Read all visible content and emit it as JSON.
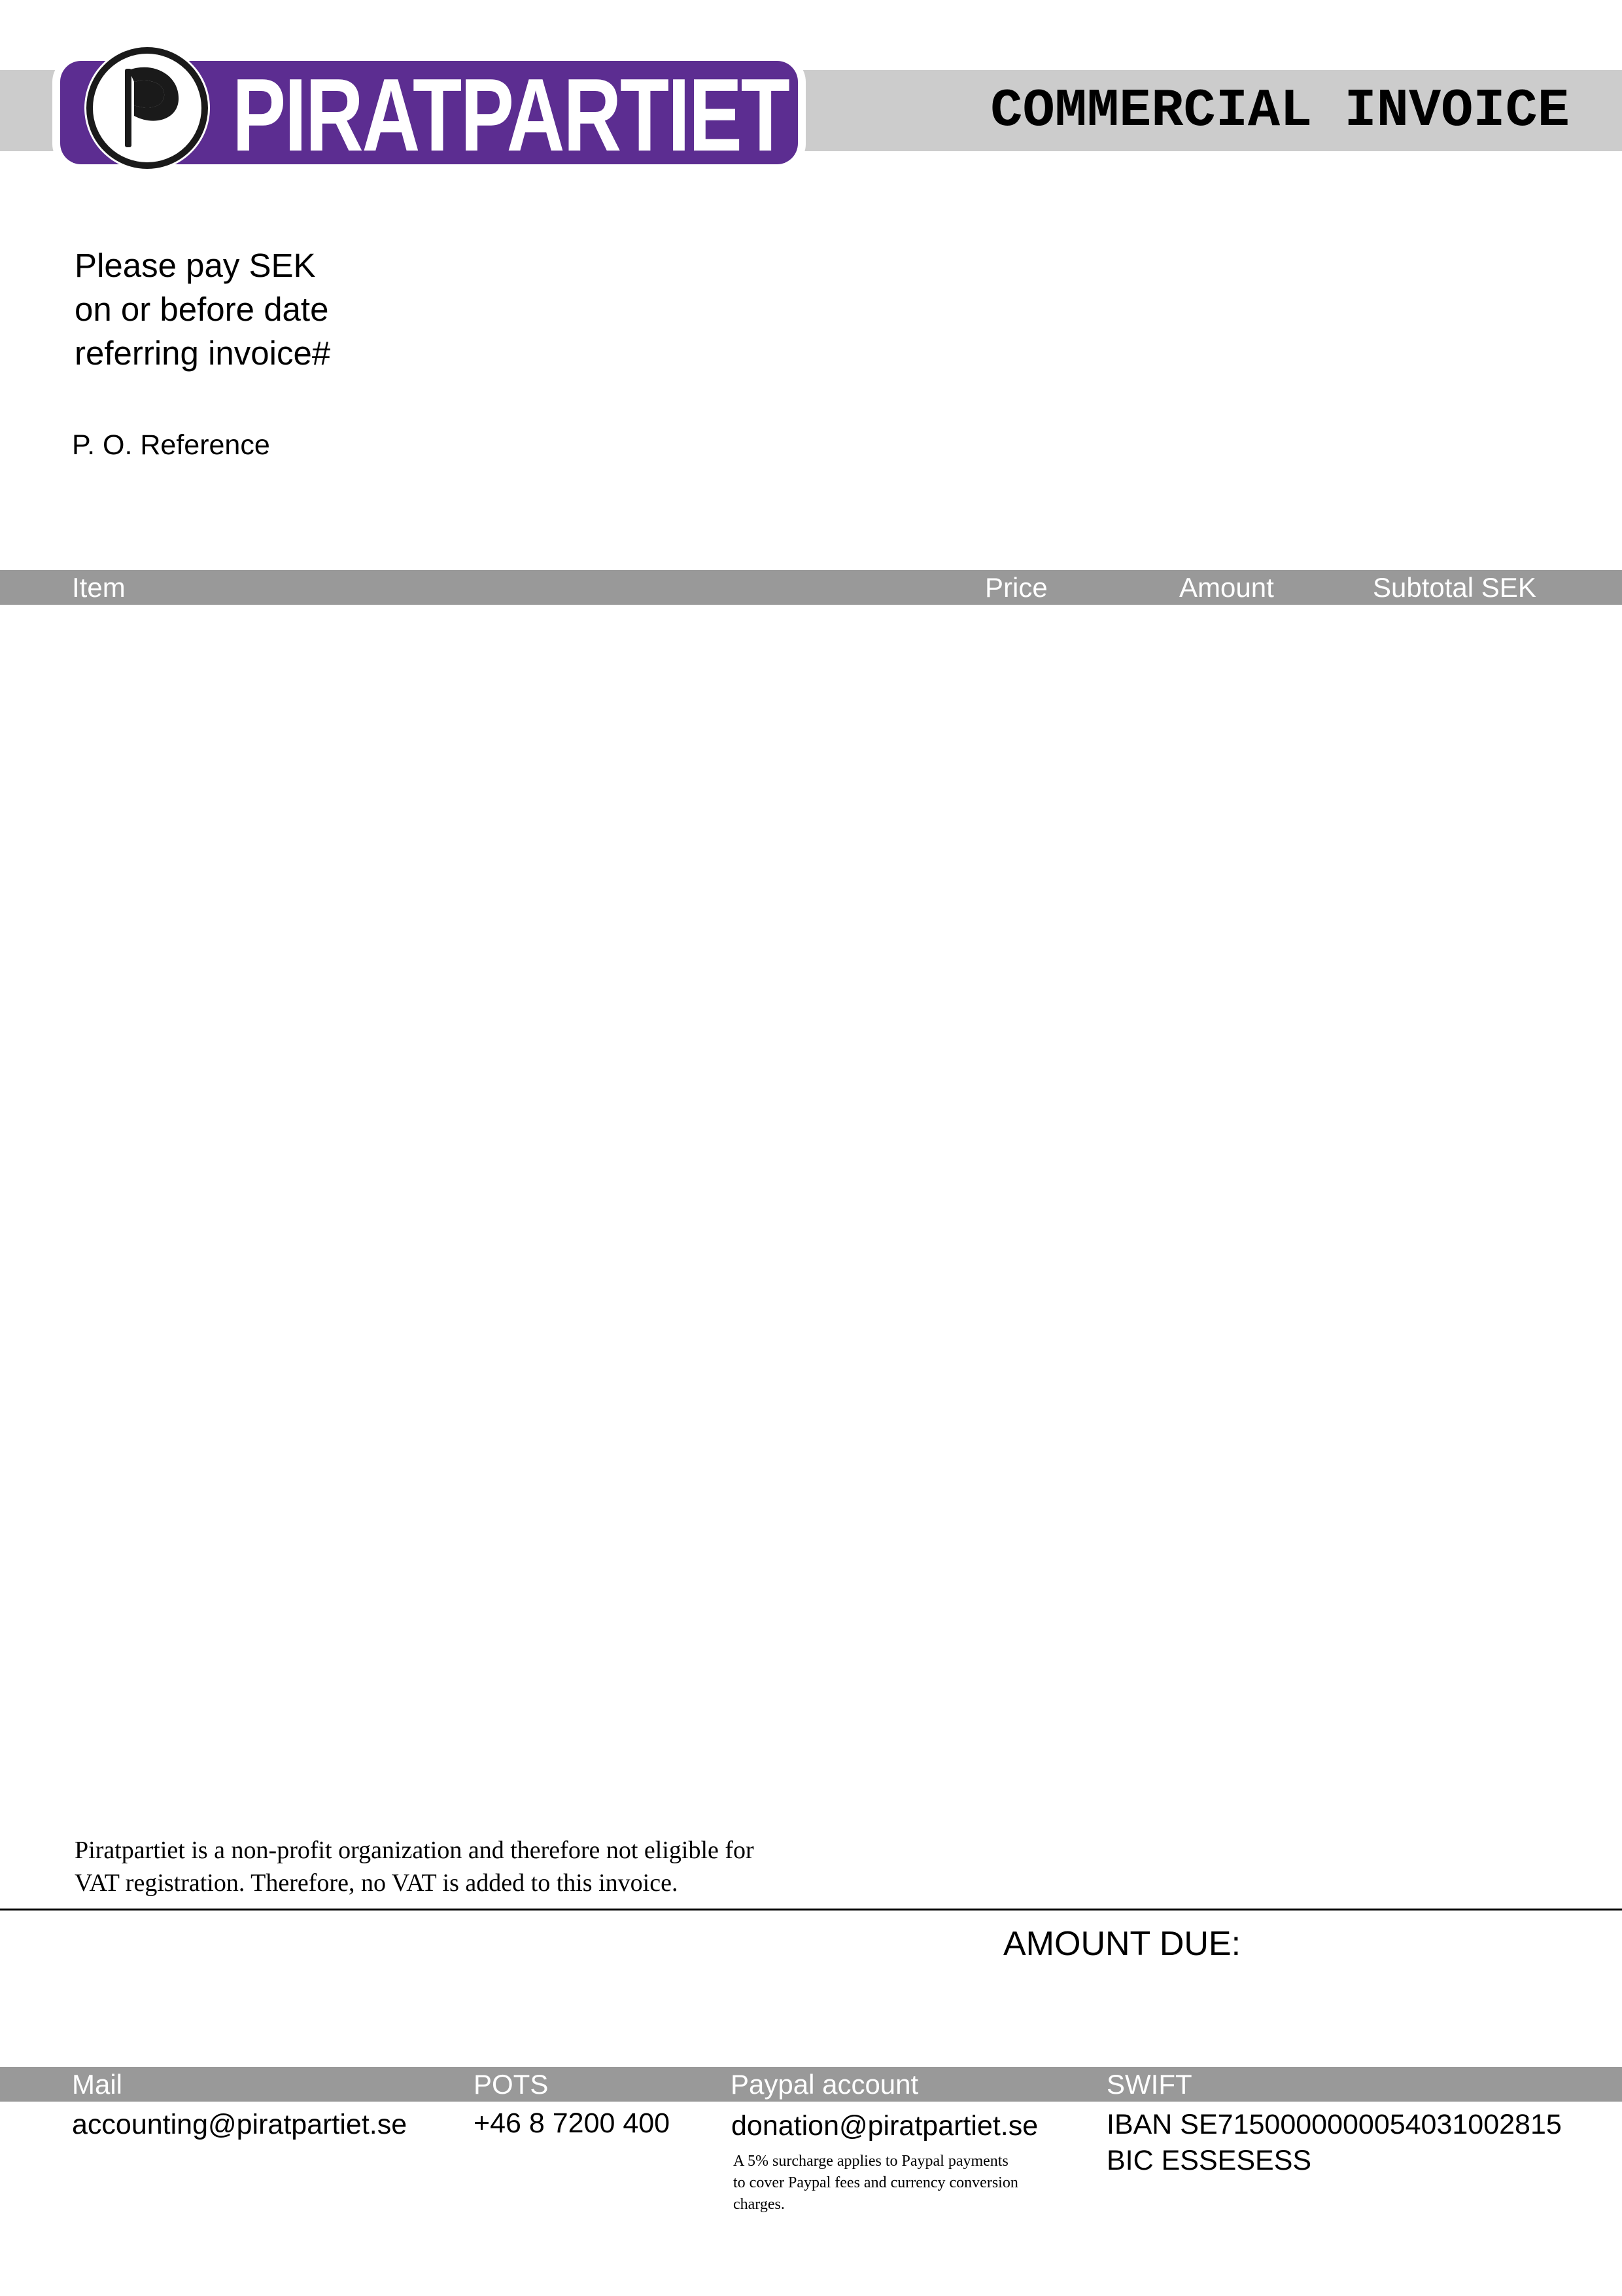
{
  "header": {
    "logo_text": "PIRATPARTIET",
    "title": "COMMERCIAL INVOICE",
    "brand_color": "#5c2d91"
  },
  "payment": {
    "line1": "Please pay SEK",
    "line2": "on or before date",
    "line3": "referring invoice#",
    "po_reference": "P. O. Reference"
  },
  "table": {
    "columns": [
      "Item",
      "Price",
      "Amount",
      "Subtotal SEK"
    ],
    "rows": []
  },
  "notes": {
    "vat_line1": "Piratpartiet is a non-profit organization and therefore not eligible for",
    "vat_line2": "VAT registration. Therefore, no VAT is added to this invoice."
  },
  "totals": {
    "amount_due_label": "AMOUNT DUE:"
  },
  "footer": {
    "mail_label": "Mail",
    "mail_value": "accounting@piratpartiet.se",
    "pots_label": "POTS",
    "pots_value": "+46 8 7200 400",
    "paypal_label": "Paypal account",
    "paypal_value": "donation@piratpartiet.se",
    "paypal_note_line1": "A 5% surcharge applies to Paypal payments",
    "paypal_note_line2": "to cover Paypal fees and currency conversion",
    "paypal_note_line3": "charges.",
    "swift_label": "SWIFT",
    "iban": "IBAN SE7150000000054031002815",
    "bic": "BIC ESSESESS"
  }
}
